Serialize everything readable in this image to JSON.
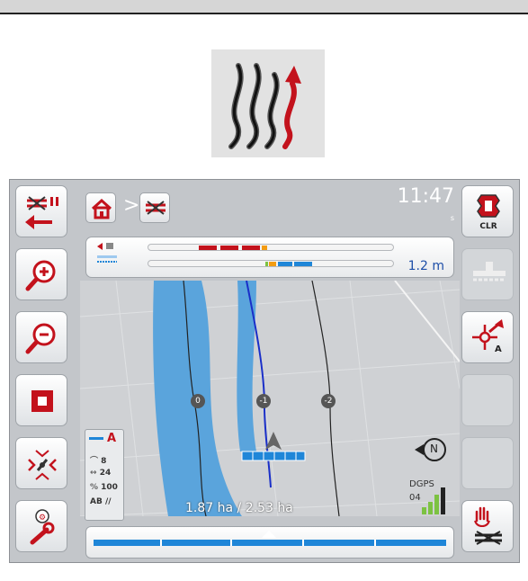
{
  "header": {
    "clock_time": "11:47",
    "clock_seconds": "s",
    "breadcrumb_separator": ">"
  },
  "lightbar": {
    "distance": "1.2 m"
  },
  "map": {
    "track_labels": [
      "0",
      "-1",
      "-2"
    ],
    "area": "1.87 ha / 2.53 ha",
    "compass_label": "N",
    "gps_mode": "DGPS",
    "satellites": "04"
  },
  "info_panel": {
    "mode": "A",
    "stat1_value": "8",
    "stat2_value": "24",
    "stat3_value": "100",
    "pattern": "AB //"
  },
  "right_buttons": {
    "clr_label": "CLR",
    "point_label": "A"
  },
  "icons": [
    "parallel-tracks-icon",
    "track-recording-pause-icon",
    "zoom-in-icon",
    "zoom-out-icon",
    "full-extent-icon",
    "gps-calibration-icon",
    "settings-wrench-icon",
    "home-icon",
    "clear-field-icon",
    "implement-icon",
    "set-point-a-icon",
    "manual-headland-icon",
    "compass-icon",
    "signal-strength-icon",
    "tractor-position-icon"
  ],
  "colors": {
    "worked_area": "#5aa4dc",
    "guidance_line": "#1a2fc8",
    "lightbar_red": "#c3121c",
    "lightbar_blue": "#1f86d8",
    "signal_green": "#7cc242"
  }
}
